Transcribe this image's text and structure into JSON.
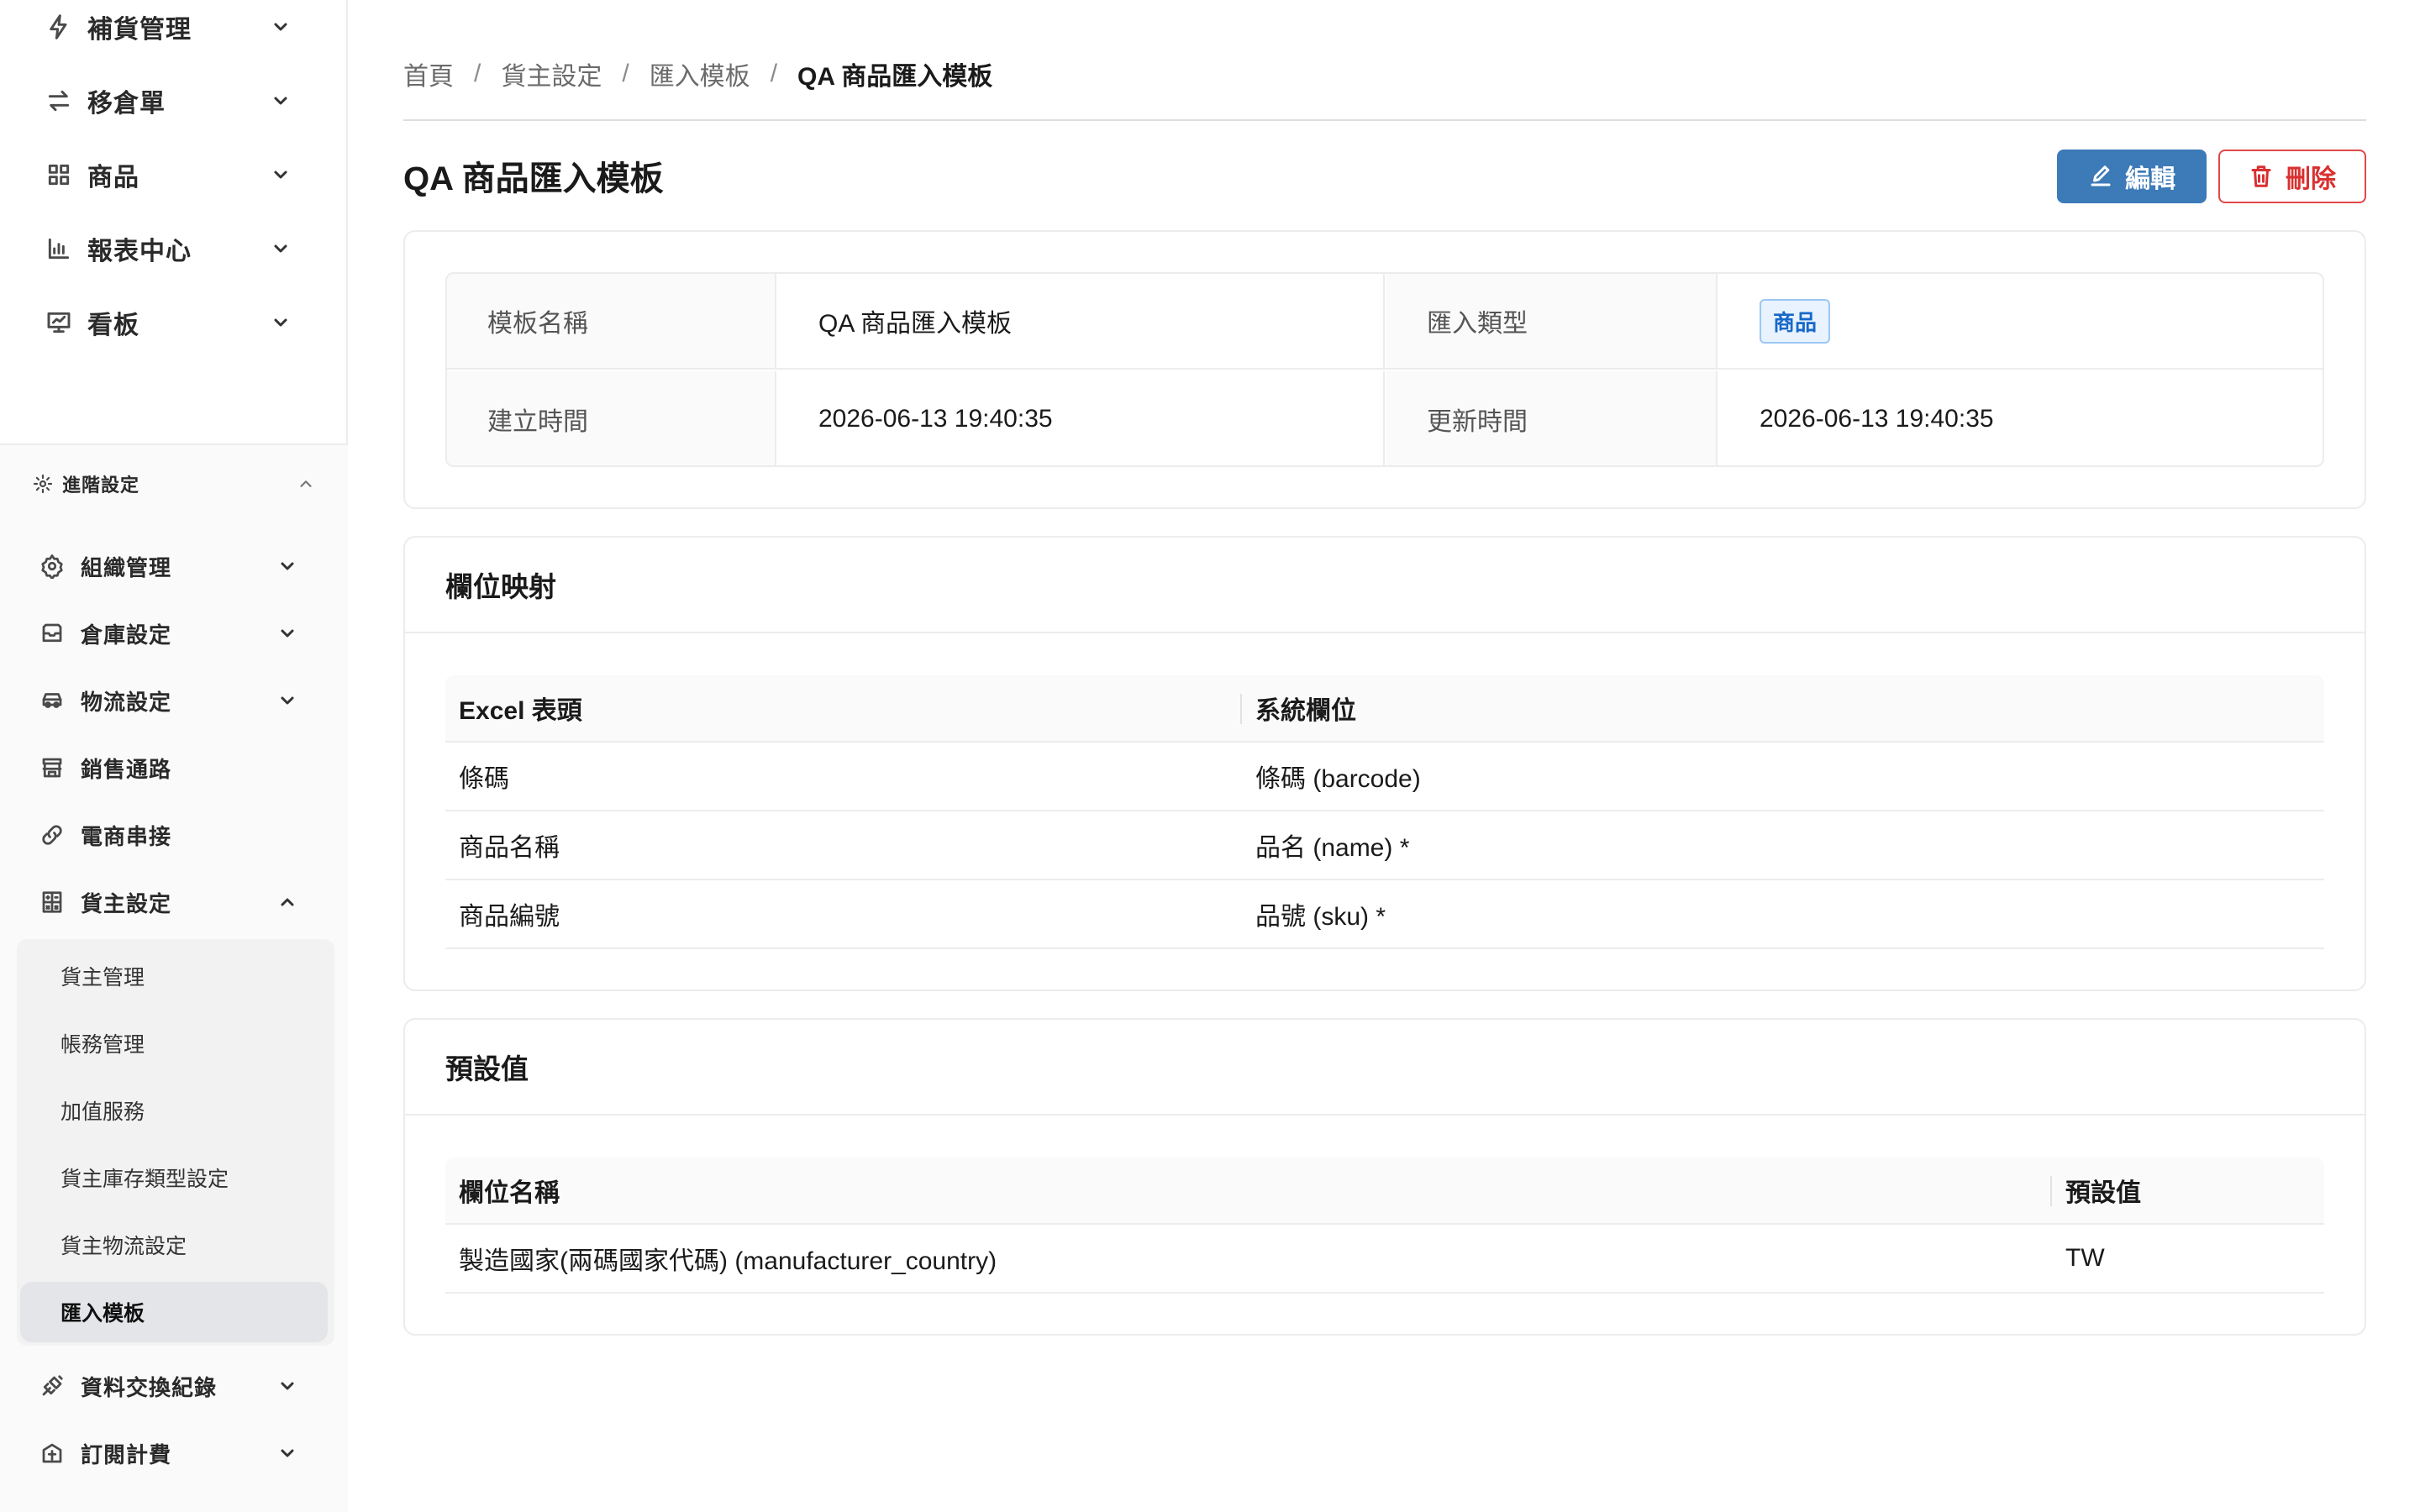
{
  "sidebar": {
    "top_items": [
      {
        "label": "補貨管理",
        "icon": "lightning-icon"
      },
      {
        "label": "移倉單",
        "icon": "transfer-icon"
      },
      {
        "label": "商品",
        "icon": "grid-icon"
      },
      {
        "label": "報表中心",
        "icon": "bar-chart-icon"
      },
      {
        "label": "看板",
        "icon": "presentation-icon"
      }
    ],
    "advanced": {
      "label": "進階設定",
      "items": [
        {
          "label": "組織管理",
          "icon": "gear-icon"
        },
        {
          "label": "倉庫設定",
          "icon": "inbox-icon"
        },
        {
          "label": "物流設定",
          "icon": "car-icon"
        },
        {
          "label": "銷售通路",
          "icon": "shop-icon"
        },
        {
          "label": "電商串接",
          "icon": "link-icon"
        },
        {
          "label": "貨主設定",
          "icon": "calculator-icon"
        }
      ],
      "sub_items": [
        {
          "label": "貨主管理"
        },
        {
          "label": "帳務管理"
        },
        {
          "label": "加值服務"
        },
        {
          "label": "貨主庫存類型設定"
        },
        {
          "label": "貨主物流設定"
        },
        {
          "label": "匯入模板"
        }
      ],
      "bottom_items": [
        {
          "label": "資料交換紀錄",
          "icon": "api-icon"
        },
        {
          "label": "訂閱計費",
          "icon": "subscription-icon"
        }
      ]
    }
  },
  "breadcrumb": [
    "首頁",
    "貨主設定",
    "匯入模板",
    "QA 商品匯入模板"
  ],
  "page": {
    "title": "QA 商品匯入模板",
    "edit_label": "編輯",
    "delete_label": "刪除"
  },
  "info": {
    "name_label": "模板名稱",
    "name_value": "QA 商品匯入模板",
    "type_label": "匯入類型",
    "type_value": "商品",
    "created_label": "建立時間",
    "created_value": "2026-06-13 19:40:35",
    "updated_label": "更新時間",
    "updated_value": "2026-06-13 19:40:35"
  },
  "mapping": {
    "title": "欄位映射",
    "columns": [
      "Excel 表頭",
      "系統欄位"
    ],
    "rows": [
      [
        "條碼",
        "條碼 (barcode)"
      ],
      [
        "商品名稱",
        "品名 (name) *"
      ],
      [
        "商品編號",
        "品號 (sku) *"
      ]
    ]
  },
  "defaults": {
    "title": "預設值",
    "columns": [
      "欄位名稱",
      "預設值"
    ],
    "rows": [
      [
        "製造國家(兩碼國家代碼) (manufacturer_country)",
        "TW"
      ]
    ]
  },
  "colors": {
    "primary": "#3c7ab8",
    "danger": "#d93030",
    "tag_text": "#1868c8",
    "tag_bg": "#e8f3ff"
  }
}
